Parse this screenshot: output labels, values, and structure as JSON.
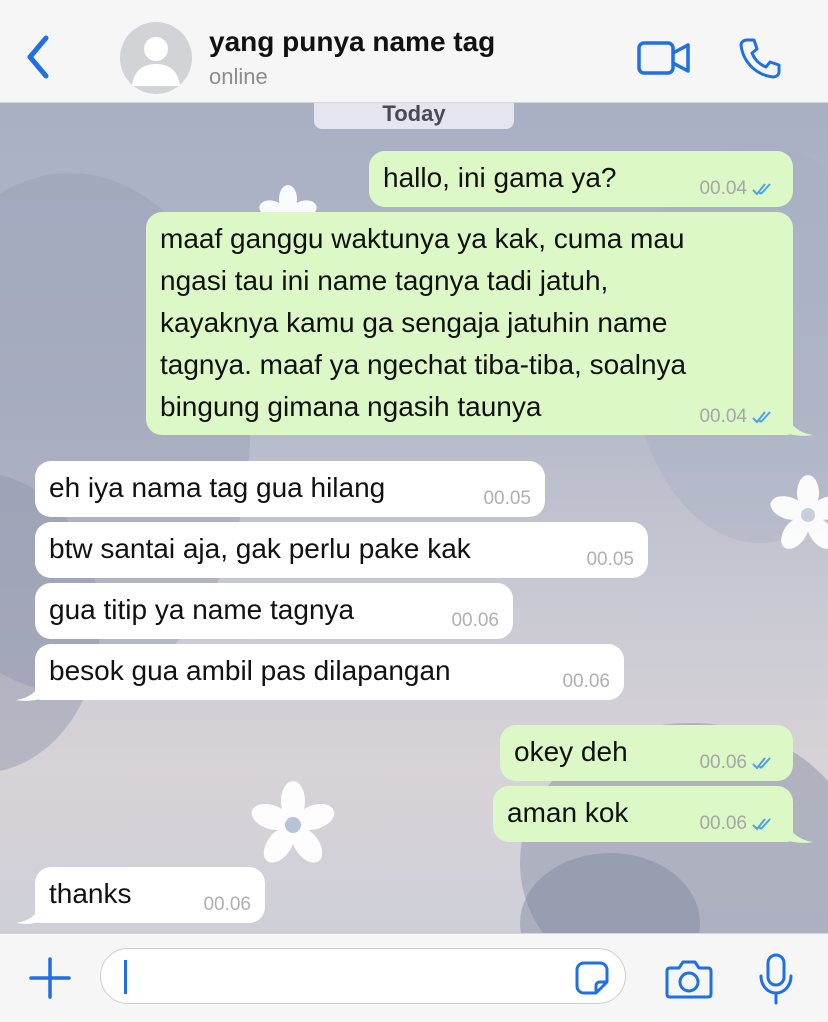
{
  "header": {
    "contact_name": "yang punya name tag",
    "status": "online"
  },
  "date_chip": "Today",
  "messages": [
    {
      "dir": "out",
      "text": "hallo, ini gama ya?",
      "time": "00.04",
      "read": true
    },
    {
      "dir": "out",
      "text": "maaf ganggu waktunya ya kak, cuma mau\nngasi tau ini name tagnya tadi jatuh,\nkayaknya kamu ga sengaja jatuhin name\ntagnya. maaf ya ngechat tiba-tiba, soalnya\nbingung gimana ngasih taunya",
      "time": "00.04",
      "read": true
    },
    {
      "dir": "in",
      "text": "eh iya nama tag gua hilang",
      "time": "00.05"
    },
    {
      "dir": "in",
      "text": "btw santai aja, gak perlu pake kak",
      "time": "00.05"
    },
    {
      "dir": "in",
      "text": "gua titip ya name tagnya",
      "time": "00.06"
    },
    {
      "dir": "in",
      "text": "besok gua ambil pas dilapangan",
      "time": "00.06"
    },
    {
      "dir": "out",
      "text": "okey deh",
      "time": "00.06",
      "read": true
    },
    {
      "dir": "out",
      "text": "aman kok",
      "time": "00.06",
      "read": true
    },
    {
      "dir": "in",
      "text": "thanks",
      "time": "00.06"
    }
  ],
  "composer": {
    "value": ""
  },
  "colors": {
    "accent": "#1f6fe5",
    "bubble_out": "#dcf8c6",
    "bubble_in": "#ffffff",
    "read_ticks": "#4fa3e0"
  },
  "icons": {
    "back": "chevron-left-icon",
    "avatar": "person-icon",
    "video": "video-camera-icon",
    "call": "phone-icon",
    "plus": "plus-icon",
    "sticker": "sticker-icon",
    "camera": "camera-icon",
    "mic": "microphone-icon"
  }
}
